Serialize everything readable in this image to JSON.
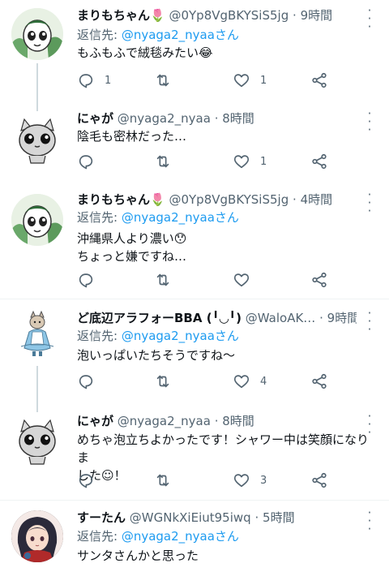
{
  "tweets": [
    {
      "display_name": "まりもちゃん🌷",
      "handle": "@0Yp8VgBKYSiS5jg",
      "time": "9時間",
      "reply_prefix": "返信先: ",
      "reply_mention": "@nyaga2_nyaaさん",
      "lines": [
        "もふもふで絨毯みたい😂"
      ],
      "counts": {
        "reply": "1",
        "retweet": "",
        "like": "1"
      }
    },
    {
      "display_name": "にゃが",
      "handle": "@nyaga2_nyaa",
      "time": "8時間",
      "lines": [
        "陰毛も密林だった…"
      ],
      "counts": {
        "reply": "",
        "retweet": "",
        "like": "1"
      }
    },
    {
      "display_name": "まりもちゃん🌷",
      "handle": "@0Yp8VgBKYSiS5jg",
      "time": "4時間",
      "reply_prefix": "返信先: ",
      "reply_mention": "@nyaga2_nyaaさん",
      "lines": [
        "沖縄県人より濃い😯",
        "ちょっと嫌ですね…"
      ],
      "counts": {
        "reply": "",
        "retweet": "",
        "like": ""
      }
    },
    {
      "display_name": "ど底辺アラフォーBBA (╹◡╹)",
      "handle": "@WaloAK…",
      "time": "9時間",
      "reply_prefix": "返信先: ",
      "reply_mention": "@nyaga2_nyaaさん",
      "lines": [
        "泡いっぱいたちそうですね〜"
      ],
      "counts": {
        "reply": "",
        "retweet": "",
        "like": "4"
      }
    },
    {
      "display_name": "にゃが",
      "handle": "@nyaga2_nyaa",
      "time": "8時間",
      "lines": [
        "めちゃ泡立ちよかったです！シャワー中は笑顔になりま",
        "した☺！"
      ],
      "counts": {
        "reply": "",
        "retweet": "",
        "like": "3"
      }
    },
    {
      "display_name": "すーたん",
      "handle": "@WGNkXiEiut95iwq",
      "time": "5時間",
      "reply_prefix": "返信先: ",
      "reply_mention": "@nyaga2_nyaaさん",
      "lines": [
        "サンタさんかと思った"
      ],
      "counts": {}
    }
  ],
  "separator": "·",
  "icons": {
    "reply": "reply-icon",
    "retweet": "retweet-icon",
    "like": "heart-icon",
    "share": "share-icon",
    "more": "more-icon"
  },
  "colors": {
    "mention": "#1d9bf0",
    "muted": "#536471",
    "thread_line": "#cfd9de"
  }
}
